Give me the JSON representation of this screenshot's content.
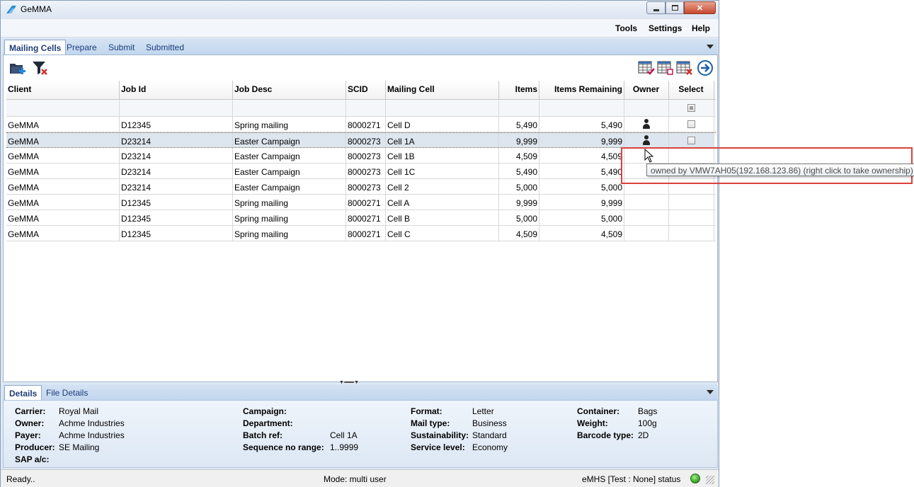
{
  "window": {
    "title": "GeMMA"
  },
  "menu": [
    "Tools",
    "Settings",
    "Help"
  ],
  "tabs": [
    "Mailing Cells",
    "Prepare",
    "Submit",
    "Submitted"
  ],
  "toolbar": {
    "left_icons": [
      "folder-add-icon",
      "clear-filter-icon"
    ],
    "right_icons": [
      "select-all-grid-icon",
      "select-none-grid-icon",
      "delete-grid-icon",
      "go-forward-icon"
    ]
  },
  "grid": {
    "columns": [
      "Client",
      "Job Id",
      "Job Desc",
      "SCID",
      "Mailing Cell",
      "Items",
      "Items Remaining",
      "Owner",
      "Select"
    ],
    "rows": [
      {
        "client": "GeMMA",
        "job_id": "D12345",
        "job_desc": "Spring mailing",
        "scid": "8000271",
        "mailing_cell": "Cell D",
        "items": "5,490",
        "items_remaining": "5,490",
        "owner": true,
        "select": true
      },
      {
        "client": "GeMMA",
        "job_id": "D23214",
        "job_desc": "Easter Campaign",
        "scid": "8000273",
        "mailing_cell": "Cell 1A",
        "items": "9,999",
        "items_remaining": "9,999",
        "owner": true,
        "select": true
      },
      {
        "client": "GeMMA",
        "job_id": "D23214",
        "job_desc": "Easter Campaign",
        "scid": "8000273",
        "mailing_cell": "Cell 1B",
        "items": "4,509",
        "items_remaining": "4,509",
        "owner": false,
        "select": false
      },
      {
        "client": "GeMMA",
        "job_id": "D23214",
        "job_desc": "Easter Campaign",
        "scid": "8000273",
        "mailing_cell": "Cell 1C",
        "items": "5,490",
        "items_remaining": "5,490",
        "owner": false,
        "select": false
      },
      {
        "client": "GeMMA",
        "job_id": "D23214",
        "job_desc": "Easter Campaign",
        "scid": "8000273",
        "mailing_cell": "Cell 2",
        "items": "5,000",
        "items_remaining": "5,000",
        "owner": false,
        "select": false
      },
      {
        "client": "GeMMA",
        "job_id": "D12345",
        "job_desc": "Spring mailing",
        "scid": "8000271",
        "mailing_cell": "Cell A",
        "items": "9,999",
        "items_remaining": "9,999",
        "owner": false,
        "select": false
      },
      {
        "client": "GeMMA",
        "job_id": "D12345",
        "job_desc": "Spring mailing",
        "scid": "8000271",
        "mailing_cell": "Cell B",
        "items": "5,000",
        "items_remaining": "5,000",
        "owner": false,
        "select": false
      },
      {
        "client": "GeMMA",
        "job_id": "D12345",
        "job_desc": "Spring mailing",
        "scid": "8000271",
        "mailing_cell": "Cell C",
        "items": "4,509",
        "items_remaining": "4,509",
        "owner": false,
        "select": false
      }
    ],
    "selected_row": 1
  },
  "tooltip": "owned by VMW7AH05(192.168.123.86) (right click to take ownership)",
  "details_tabs": [
    "Details",
    "File Details"
  ],
  "details": {
    "col1": [
      {
        "label": "Carrier:",
        "value": "Royal Mail"
      },
      {
        "label": "Owner:",
        "value": "Achme Industries"
      },
      {
        "label": "Payer:",
        "value": "Achme Industries"
      },
      {
        "label": "Producer:",
        "value": "SE Mailing"
      },
      {
        "label": "SAP a/c:",
        "value": ""
      }
    ],
    "col2": [
      {
        "label": "Campaign:",
        "value": ""
      },
      {
        "label": "Department:",
        "value": ""
      },
      {
        "label": "Batch ref:",
        "value": "Cell 1A"
      },
      {
        "label": "Sequence no range:",
        "value": "1..9999"
      }
    ],
    "col3": [
      {
        "label": "Format:",
        "value": "Letter"
      },
      {
        "label": "Mail type:",
        "value": "Business"
      },
      {
        "label": "Sustainability:",
        "value": "Standard"
      },
      {
        "label": "Service level:",
        "value": "Economy"
      }
    ],
    "col4": [
      {
        "label": "Container:",
        "value": "Bags"
      },
      {
        "label": "Weight:",
        "value": "100g"
      },
      {
        "label": "Barcode type:",
        "value": "2D"
      }
    ]
  },
  "status": {
    "left": "Ready..",
    "mode": "Mode: multi user",
    "emhs": "eMHS [Test : None] status"
  },
  "colors": {
    "highlight": "#d9423c",
    "selected_row": "#dde5ee",
    "status_ok": "#2f9c1e"
  }
}
